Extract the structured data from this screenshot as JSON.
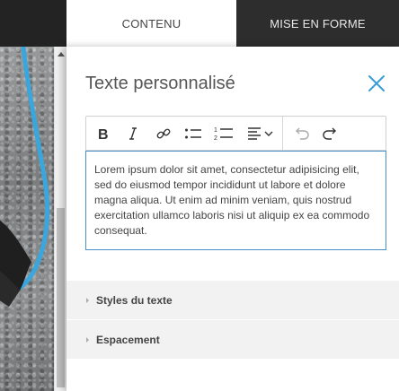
{
  "tabs": [
    {
      "label": "CONTENU",
      "active": true
    },
    {
      "label": "MISE EN FORME",
      "active": false
    }
  ],
  "panel": {
    "title": "Texte personnalisé",
    "close_icon": "close-icon"
  },
  "toolbar": {
    "buttons": [
      "bold-icon",
      "italic-icon",
      "link-icon",
      "bullet-list-icon",
      "numbered-list-icon",
      "align-dropdown-icon",
      "undo-icon",
      "redo-icon"
    ]
  },
  "editor": {
    "content": "Lorem ipsum dolor sit amet, consectetur adipisicing elit, sed do eiusmod tempor incididunt ut labore et dolore magna aliqua. Ut enim ad minim veniam, quis nostrud exercitation ullamco laboris nisi ut aliquip ex ea commodo consequat."
  },
  "sections": [
    {
      "label": "Styles du texte"
    },
    {
      "label": "Espacement"
    }
  ],
  "colors": {
    "accent": "#3a9bd9",
    "border_focus": "#4a90c8"
  }
}
